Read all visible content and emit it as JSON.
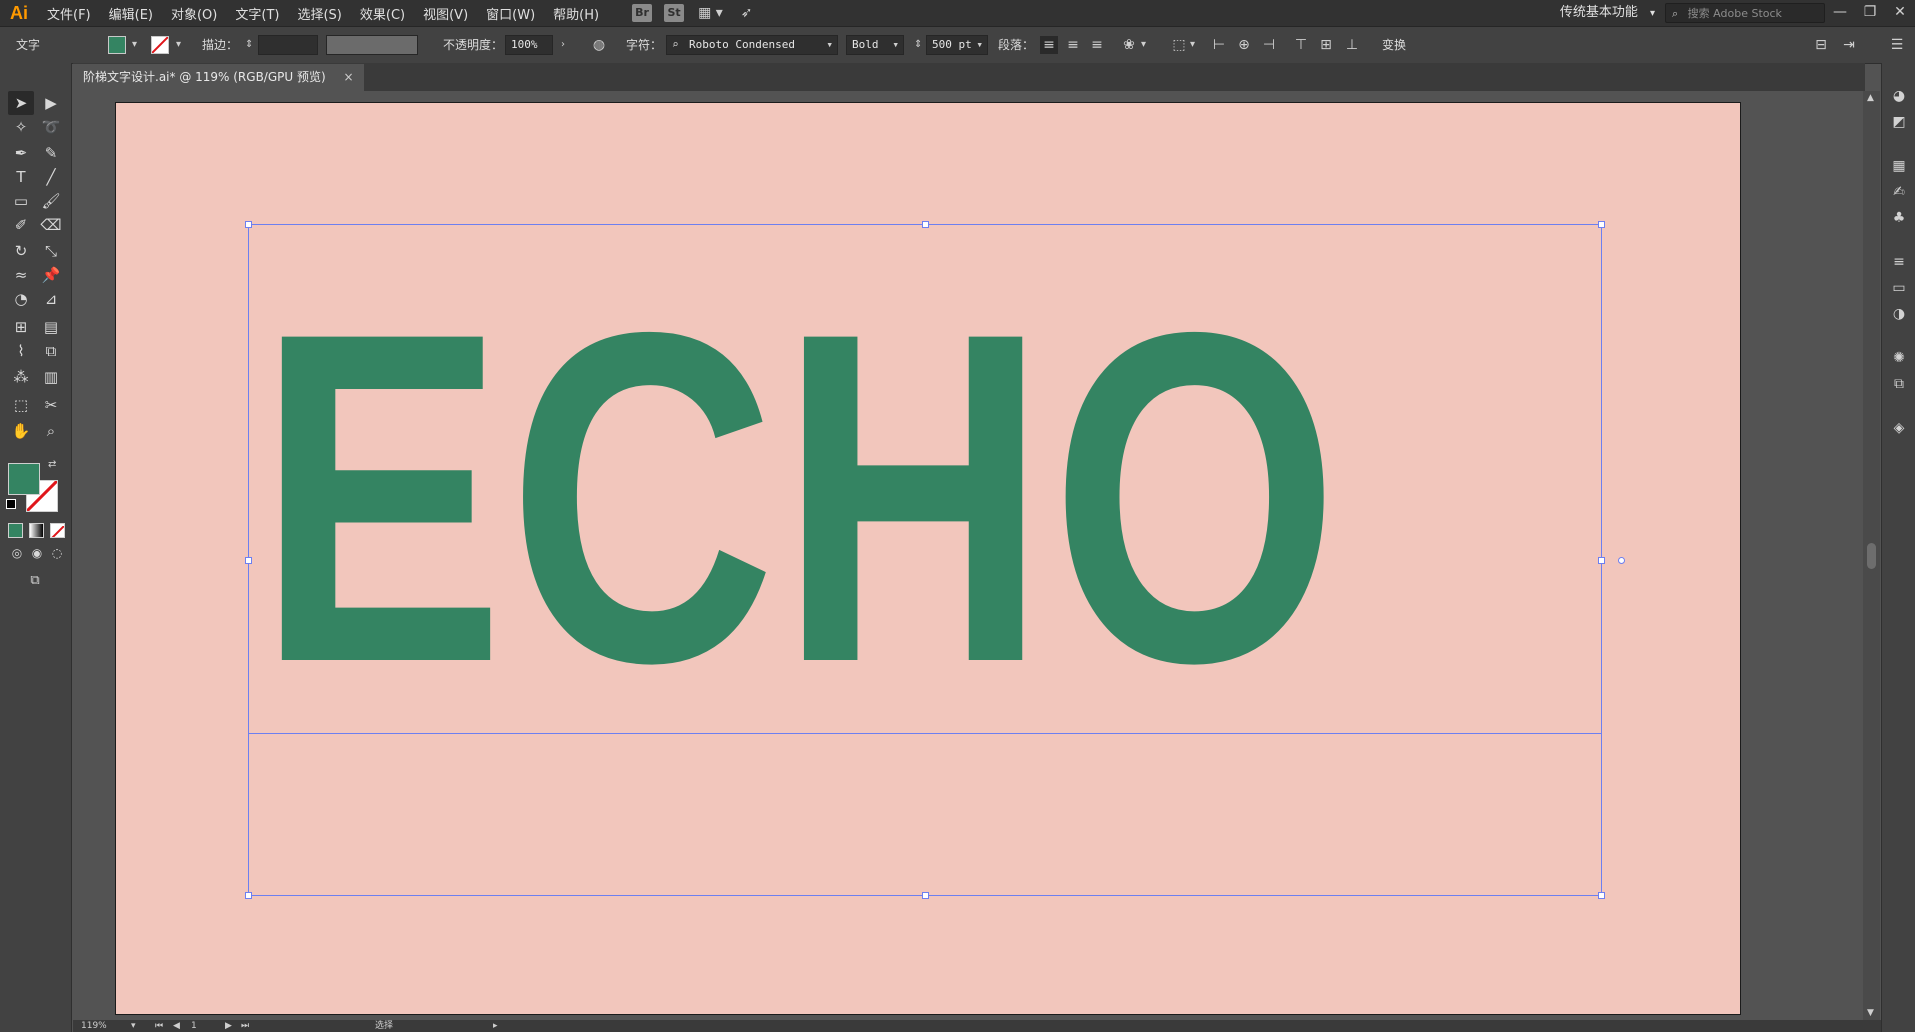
{
  "app": {
    "logo": "Ai"
  },
  "menu": {
    "items": [
      "文件(F)",
      "编辑(E)",
      "对象(O)",
      "文字(T)",
      "选择(S)",
      "效果(C)",
      "视图(V)",
      "窗口(W)",
      "帮助(H)"
    ],
    "bridge_label": "Br",
    "stock_label": "St",
    "workspace": "传统基本功能",
    "search_placeholder": "搜索 Adobe Stock",
    "win_minimize": "—",
    "win_restore": "❐",
    "win_close": "✕"
  },
  "control": {
    "section_label": "文字",
    "fill_color": "#348462",
    "stroke_label": "描边：",
    "stroke_value": "",
    "opacity_label": "不透明度：",
    "opacity_value": "100%",
    "character_label": "字符：",
    "font_family": "Roboto Condensed",
    "font_style": "Bold",
    "font_size": "500 pt",
    "paragraph_label": "段落：",
    "transform_label": "变换"
  },
  "document": {
    "tab_title": "阶梯文字设计.ai* @ 119% (RGB/GPU 预览)",
    "tab_close": "×"
  },
  "canvas": {
    "artboard_color": "#f2c6bc",
    "text": "ECHO",
    "text_color": "#348462",
    "selection_color": "#6d7ff0"
  },
  "status": {
    "zoom": "119%",
    "page": "1",
    "mode": "选择"
  }
}
